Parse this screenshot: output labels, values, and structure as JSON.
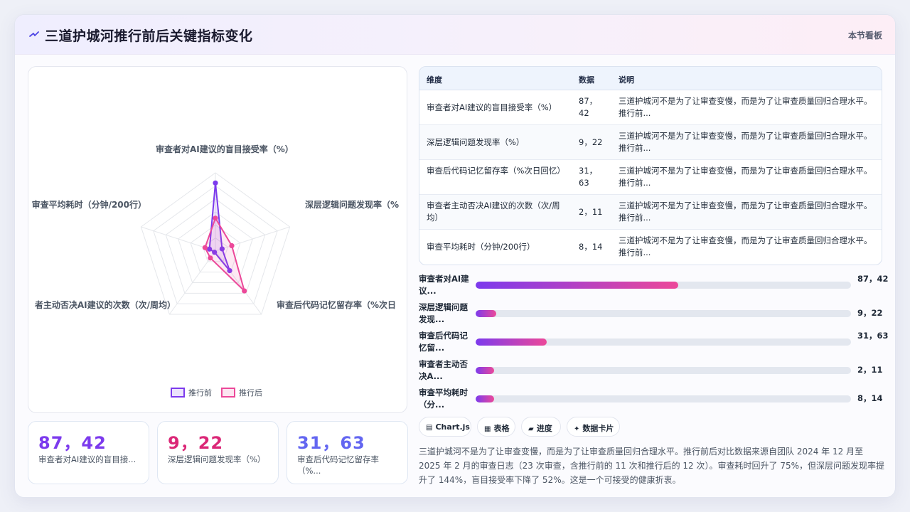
{
  "header": {
    "icon": "sparkle-icon",
    "title": "三道护城河推行前后关键指标变化",
    "tag": "本节看板"
  },
  "chart_data": {
    "type": "radar",
    "axes": [
      "审查者对AI建议的盲目接受率（%）",
      "深层逻辑问题发现率（%",
      "审查后代码记忆留存率（%次日",
      "审查者主动否决AI建议的次数（次/周均）",
      "审查平均耗时（分钟/200行）"
    ],
    "axis_label_display": [
      "审查者对AI建议的盲目接受率（%）",
      "深层逻辑问题发现率（%",
      "审查后代码记忆留存率（%次日",
      "者主动否决AI建议的次数（次/周均）",
      "审查平均耗时（分钟/200行）"
    ],
    "series": [
      {
        "name": "推行前",
        "values": [
          87,
          9,
          31,
          2,
          8
        ],
        "color": "#7c3aed"
      },
      {
        "name": "推行后",
        "values": [
          42,
          22,
          63,
          11,
          14
        ],
        "color": "#ec4899"
      }
    ],
    "rmax": 100,
    "legend": "bottom"
  },
  "table": {
    "headers": {
      "dim": "维度",
      "data": "数据",
      "note": "说明"
    },
    "rows": [
      {
        "dim": "审查者对AI建议的盲目接受率（%）",
        "data": "87，42",
        "note": "三道护城河不是为了让审查变慢，而是为了让审查质量回归合理水平。推行前..."
      },
      {
        "dim": "深层逻辑问题发现率（%）",
        "data": "9，22",
        "note": "三道护城河不是为了让审查变慢，而是为了让审查质量回归合理水平。推行前..."
      },
      {
        "dim": "审查后代码记忆留存率（%次日回忆）",
        "data": "31，63",
        "note": "三道护城河不是为了让审查变慢，而是为了让审查质量回归合理水平。推行前..."
      },
      {
        "dim": "审查者主动否决AI建议的次数（次/周均）",
        "data": "2，11",
        "note": "三道护城河不是为了让审查变慢，而是为了让审查质量回归合理水平。推行前..."
      },
      {
        "dim": "审查平均耗时（分钟/200行）",
        "data": "8，14",
        "note": "三道护城河不是为了让审查变慢，而是为了让审查质量回归合理水平。推行前..."
      }
    ]
  },
  "progress": [
    {
      "label": "审查者对AI建议...",
      "value": "87，42",
      "fill": 0.54
    },
    {
      "label": "深层逻辑问题发现...",
      "value": "9，22",
      "fill": 0.055
    },
    {
      "label": "审查后代码记忆留...",
      "value": "31，63",
      "fill": 0.19
    },
    {
      "label": "审查者主动否决A...",
      "value": "2，11",
      "fill": 0.05
    },
    {
      "label": "审查平均耗时（分...",
      "value": "8，14",
      "fill": 0.05
    }
  ],
  "kpis": [
    {
      "value": "87，42",
      "label": "审查者对AI建议的盲目接...",
      "color": "#7c3aed"
    },
    {
      "value": "9，22",
      "label": "深层逻辑问题发现率（%）",
      "color": "#db2777"
    },
    {
      "value": "31，63",
      "label": "审查后代码记忆留存率（%...",
      "color": "#6366f1"
    }
  ],
  "chips": [
    {
      "icon": "chart-icon",
      "glyph": "▤",
      "label": "Chart.js"
    },
    {
      "icon": "table-icon",
      "glyph": "▦",
      "label": "表格"
    },
    {
      "icon": "progress-icon",
      "glyph": "▰",
      "label": "进度"
    },
    {
      "icon": "card-icon",
      "glyph": "✦",
      "label": "数据卡片"
    }
  ],
  "summary": "三道护城河不是为了让审查变慢，而是为了让审查质量回归合理水平。推行前后对比数据来源自团队 2024 年 12 月至 2025 年 2 月的审查日志（23 次审查，含推行前的 11 次和推行后的 12 次）。审查耗时回升了 75%，但深层问题发现率提升了 144%，盲目接受率下降了 52%。这是一个可接受的健康折衷。"
}
